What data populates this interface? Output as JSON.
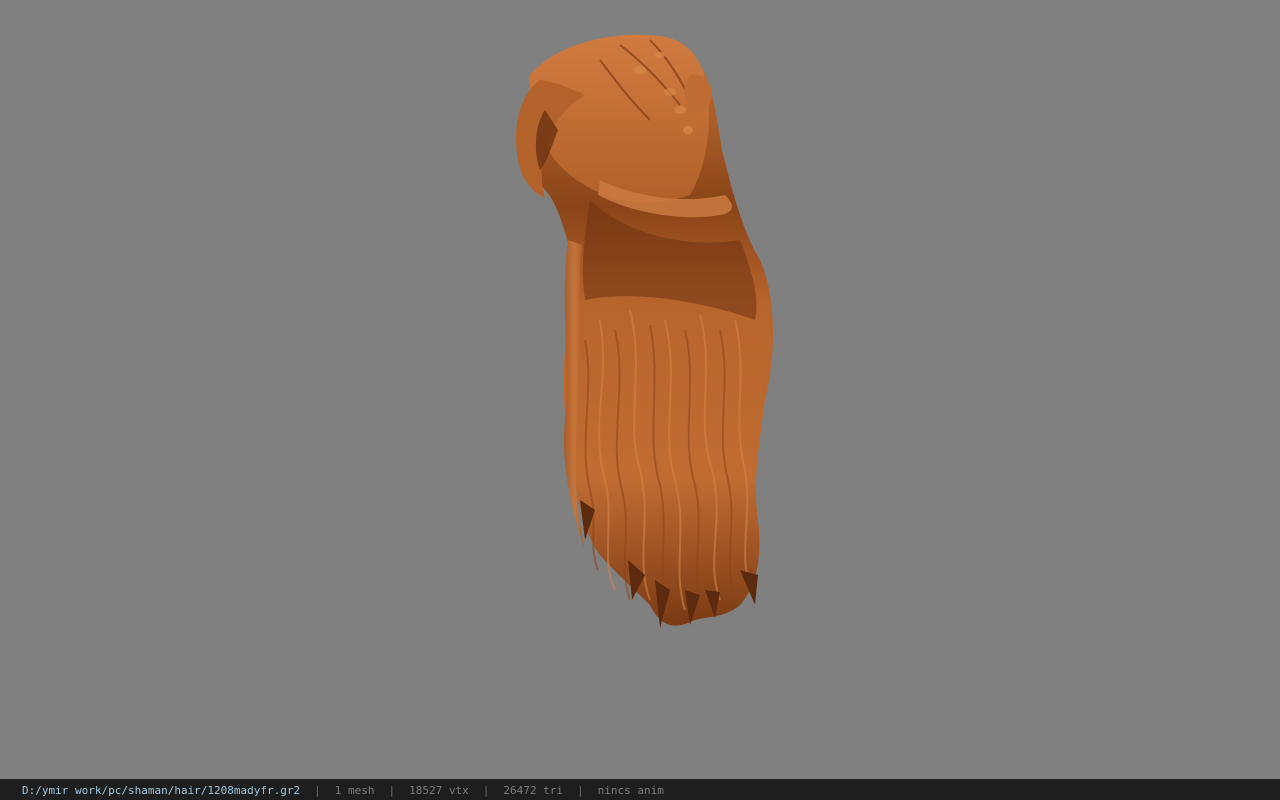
{
  "viewport": {
    "background_color": "#808080",
    "model_color": "#c2703a",
    "model_shadow_color": "#6a3414",
    "model_name": "hair"
  },
  "status": {
    "file_path": "D:/ymir work/pc/shaman/hair/1208madyfr.gr2",
    "separator": "|",
    "mesh_count": "1 mesh",
    "vertex_count": "18527 vtx",
    "triangle_count": "26472 tri",
    "anim_status": "nincs anim"
  }
}
